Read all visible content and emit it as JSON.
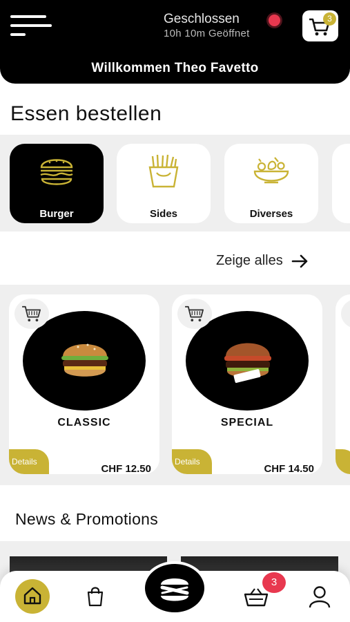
{
  "header": {
    "status_closed": "Geschlossen",
    "status_open_in": "10h 10m Geöffnet",
    "cart_count": "3",
    "welcome": "Willkommen Theo Favetto",
    "menu_icon": "hamburger-menu-icon",
    "cart_icon": "shopping-cart-icon"
  },
  "order": {
    "title": "Essen bestellen",
    "categories": [
      {
        "label": "Burger",
        "icon": "burger-icon",
        "active": true
      },
      {
        "label": "Sides",
        "icon": "fries-icon",
        "active": false
      },
      {
        "label": "Diverses",
        "icon": "salad-bowl-icon",
        "active": false
      }
    ],
    "see_all": "Zeige alles"
  },
  "products": [
    {
      "name": "CLASSIC",
      "price": "CHF 12.50",
      "details": "Details"
    },
    {
      "name": "SPECIAL",
      "price": "CHF 14.50",
      "details": "Details"
    }
  ],
  "news": {
    "title": "News & Promotions"
  },
  "bottom_nav": {
    "basket_count": "3",
    "items": [
      "home-icon",
      "shopping-bag-icon",
      "brand-logo",
      "basket-icon",
      "user-icon"
    ]
  },
  "colors": {
    "accent": "#c9b335",
    "dark": "#000000",
    "badge_red": "#e8384f",
    "strip_bg": "#efefef"
  }
}
